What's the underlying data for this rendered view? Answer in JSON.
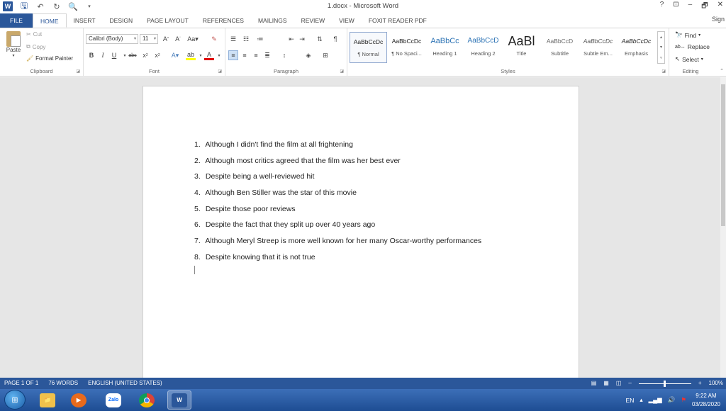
{
  "app": {
    "document_title": "1.docx - Microsoft Word",
    "sign_in": "Sign",
    "window_controls": [
      "?",
      "⊡",
      "–",
      "🗗",
      "✕"
    ]
  },
  "tabs": [
    "FILE",
    "HOME",
    "INSERT",
    "DESIGN",
    "PAGE LAYOUT",
    "REFERENCES",
    "MAILINGS",
    "REVIEW",
    "VIEW",
    "FOXIT READER PDF"
  ],
  "active_tab": "HOME",
  "ribbon": {
    "clipboard": {
      "label": "Clipboard",
      "paste": "Paste",
      "cut": "Cut",
      "copy": "Copy",
      "format_painter": "Format Painter"
    },
    "font": {
      "label": "Font",
      "font_name": "Calibri (Body)",
      "font_size": "11"
    },
    "paragraph": {
      "label": "Paragraph"
    },
    "styles": {
      "label": "Styles",
      "items": [
        {
          "preview": "AaBbCcDc",
          "name": "¶ Normal",
          "selected": true
        },
        {
          "preview": "AaBbCcDc",
          "name": "¶ No Spaci..."
        },
        {
          "preview": "AaBbCc",
          "name": "Heading 1"
        },
        {
          "preview": "AaBbCcD",
          "name": "Heading 2"
        },
        {
          "preview": "AaBl",
          "name": "Title"
        },
        {
          "preview": "AaBbCcD",
          "name": "Subtitle"
        },
        {
          "preview": "AaBbCcDc",
          "name": "Subtle Em..."
        },
        {
          "preview": "AaBbCcDc",
          "name": "Emphasis"
        }
      ]
    },
    "editing": {
      "label": "Editing",
      "find": "Find",
      "replace": "Replace",
      "select": "Select"
    }
  },
  "document": {
    "items": [
      {
        "num": "1.",
        "text": "Although I didn't find the film at all frightening"
      },
      {
        "num": "2.",
        "text": "Although most critics agreed that the film was her best ever"
      },
      {
        "num": "3.",
        "text": "Despite being a well-reviewed hit"
      },
      {
        "num": "4.",
        "text": "Although Ben Stiller was the star of this movie"
      },
      {
        "num": "5.",
        "text": "Despite those poor reviews"
      },
      {
        "num": "6.",
        "text": "Despite the fact that they split up over 40 years ago"
      },
      {
        "num": "7.",
        "text": "Although Meryl Streep is more well known for her many Oscar-worthy performances"
      },
      {
        "num": "8.",
        "text": "Despite knowing that it is not true"
      }
    ]
  },
  "status": {
    "page": "PAGE 1 OF 1",
    "words": "76 WORDS",
    "language": "ENGLISH (UNITED STATES)",
    "zoom": "100%"
  },
  "taskbar": {
    "apps": [
      "Explorer",
      "Media Player",
      "Zalo",
      "Chrome",
      "Word"
    ],
    "zalo_label": "Zalo",
    "lang": "EN",
    "time": "9:22 AM",
    "date": "03/28/2020"
  },
  "colors": {
    "accent": "#2b579a"
  }
}
